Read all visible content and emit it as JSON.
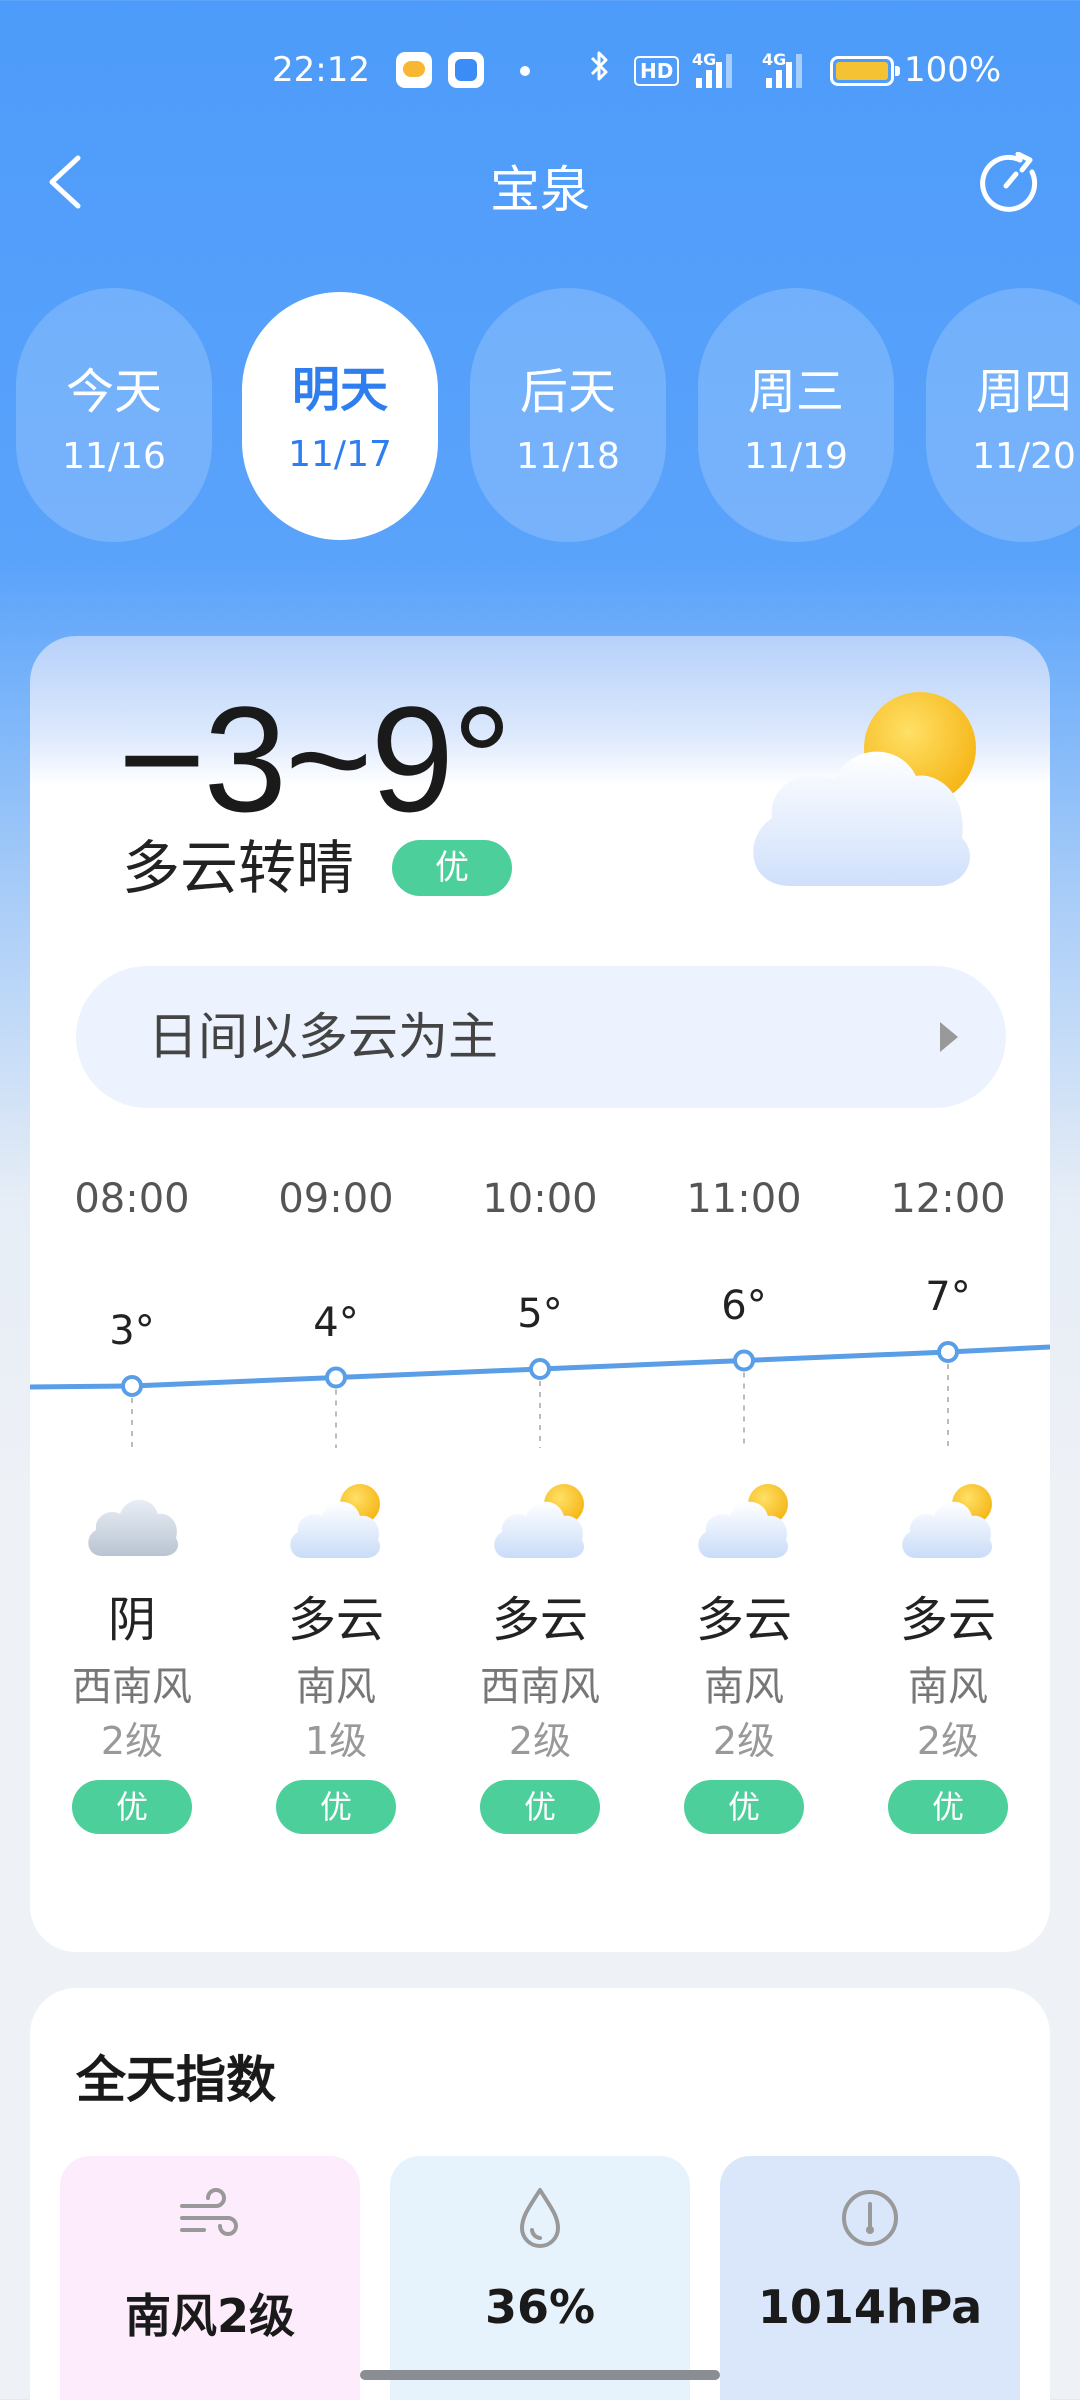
{
  "status_bar": {
    "time": "22:12",
    "hd_label": "HD",
    "signal1_label": "4G",
    "signal2_label": "4G",
    "battery_text": "100%"
  },
  "header": {
    "title": "宝泉"
  },
  "days": [
    {
      "name": "今天",
      "date": "11/16",
      "active": false
    },
    {
      "name": "明天",
      "date": "11/17",
      "active": true
    },
    {
      "name": "后天",
      "date": "11/18",
      "active": false
    },
    {
      "name": "周三",
      "date": "11/19",
      "active": false
    },
    {
      "name": "周四",
      "date": "11/20",
      "active": false
    }
  ],
  "today": {
    "temp_range": "−3~9°",
    "description": "多云转晴",
    "aqi": "优",
    "icon": "cloud-sun-icon",
    "summary": "日间以多云为主"
  },
  "hourly": [
    {
      "time": "08:00",
      "temp": "3°",
      "temp_value": 3,
      "cond": "阴",
      "icon": "overcast-icon",
      "wind_dir": "西南风",
      "wind_level": "2级",
      "aqi": "优"
    },
    {
      "time": "09:00",
      "temp": "4°",
      "temp_value": 4,
      "cond": "多云",
      "icon": "cloud-sun-icon",
      "wind_dir": "南风",
      "wind_level": "1级",
      "aqi": "优"
    },
    {
      "time": "10:00",
      "temp": "5°",
      "temp_value": 5,
      "cond": "多云",
      "icon": "cloud-sun-icon",
      "wind_dir": "西南风",
      "wind_level": "2级",
      "aqi": "优"
    },
    {
      "time": "11:00",
      "temp": "6°",
      "temp_value": 6,
      "cond": "多云",
      "icon": "cloud-sun-icon",
      "wind_dir": "南风",
      "wind_level": "2级",
      "aqi": "优"
    },
    {
      "time": "12:00",
      "temp": "7°",
      "temp_value": 7,
      "cond": "多云",
      "icon": "cloud-sun-icon",
      "wind_dir": "南风",
      "wind_level": "2级",
      "aqi": "优"
    }
  ],
  "indices": {
    "title": "全天指数",
    "tiles": [
      {
        "icon": "wind-icon",
        "value": "南风2级"
      },
      {
        "icon": "humidity-drop-icon",
        "value": "36%"
      },
      {
        "icon": "pressure-gauge-icon",
        "value": "1014hPa"
      }
    ]
  },
  "colors": {
    "accent": "#2f7ef0",
    "aqi_good": "#4ccf9b",
    "temp_line": "#5a9ee8"
  }
}
